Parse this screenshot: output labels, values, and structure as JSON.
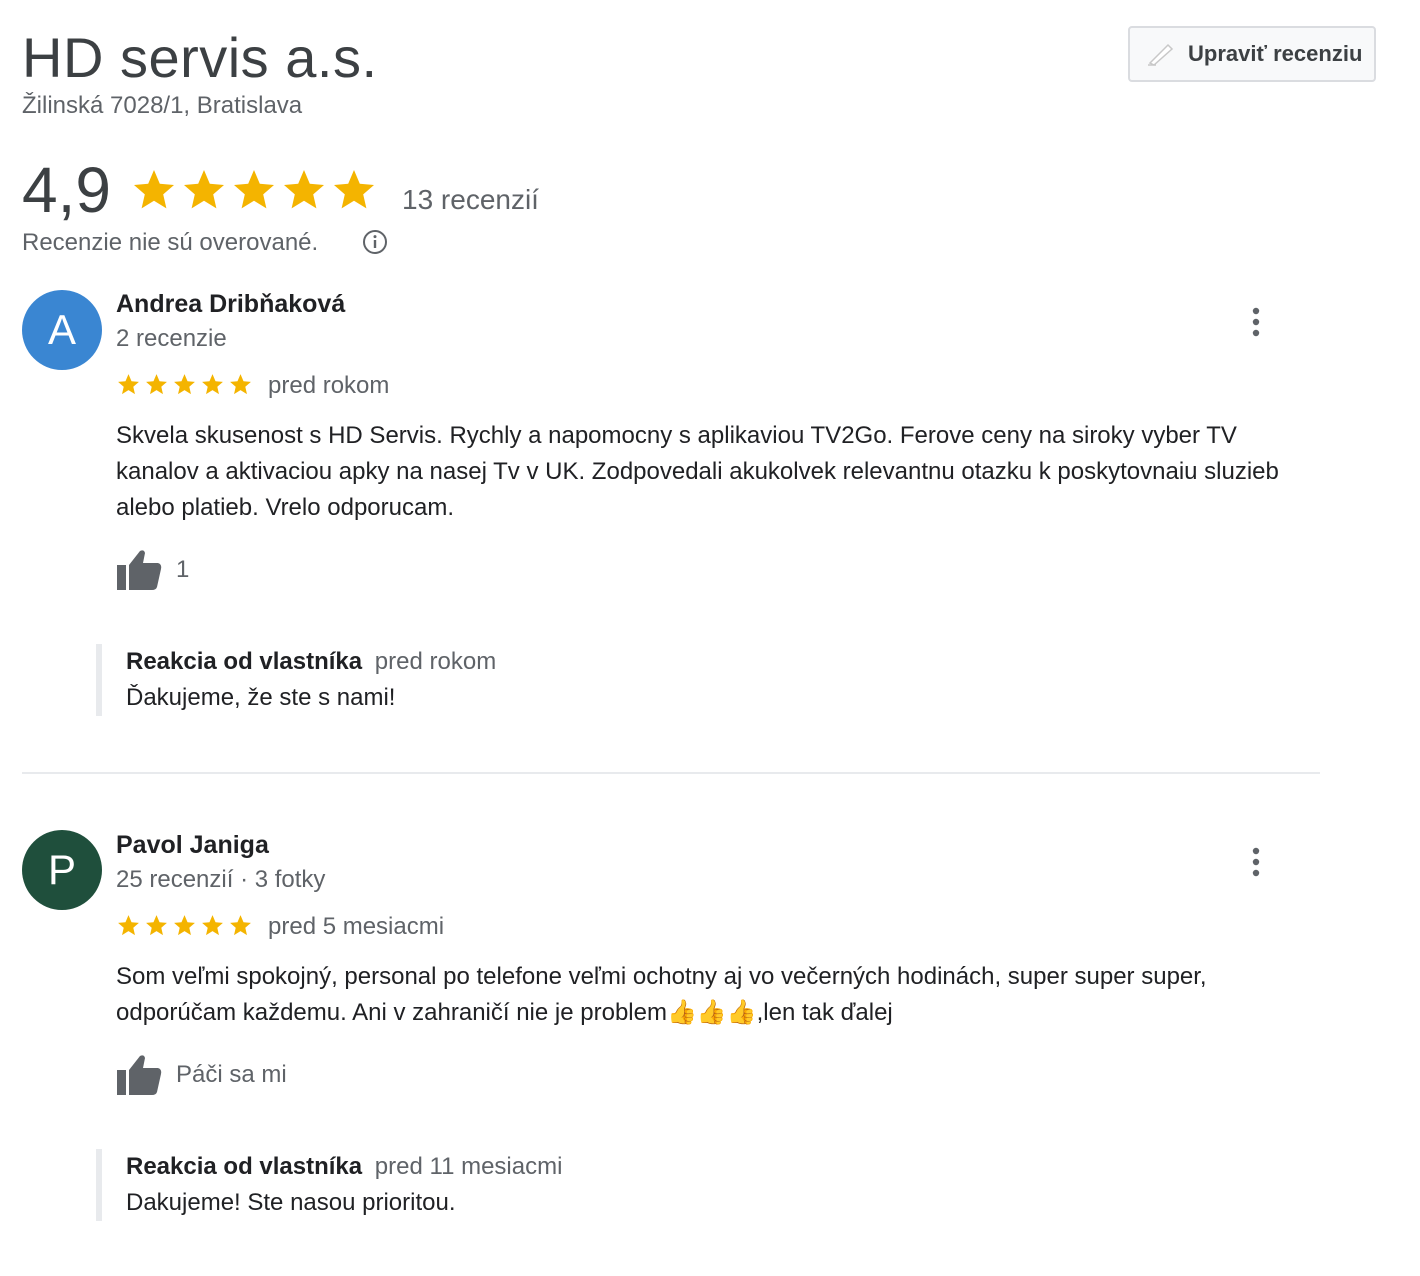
{
  "business": {
    "name": "HD servis a.s.",
    "address": "Žilinská 7028/1, Bratislava",
    "edit_review_label": "Upraviť recenziu"
  },
  "summary": {
    "rating": "4,9",
    "stars": 5,
    "review_count": "13 recenzií",
    "unverified_note": "Recenzie nie sú overované."
  },
  "colors": {
    "star": "#f4b400",
    "avatar_a": "#3a86d2",
    "avatar_p": "#1f4f3c",
    "thumb": "#5f6368"
  },
  "reviews": [
    {
      "avatar_letter": "A",
      "name": "Andrea Dribňaková",
      "meta": "2 recenzie",
      "stars": 5,
      "time": "pred rokom",
      "text": "Skvela skusenost s HD Servis. Rychly a napomocny s aplikaviou TV2Go. Ferove ceny na siroky vyber TV kanalov a aktivaciou apky na nasej Tv v UK. Zodpovedali akukolvek relevantnu otazku k poskytovnaiu sluzieb alebo platieb. Vrelo odporucam.",
      "like_label": "1",
      "owner_reply": {
        "by": "Reakcia od vlastníka",
        "time": "pred rokom",
        "text": "Ďakujeme, že ste s nami!"
      }
    },
    {
      "avatar_letter": "P",
      "name": "Pavol Janiga",
      "meta": "25 recenzií · 3 fotky",
      "stars": 5,
      "time": "pred 5 mesiacmi",
      "text": "Som veľmi spokojný, personal po telefone veľmi ochotny aj vo večerných hodinách, super super super, odporúčam každemu. Ani v zahraničí nie je problem👍👍👍,len tak ďalej",
      "like_label": "Páči sa mi",
      "owner_reply": {
        "by": "Reakcia od vlastníka",
        "time": "pred 11 mesiacmi",
        "text": "Dakujeme! Ste nasou prioritou."
      }
    }
  ]
}
